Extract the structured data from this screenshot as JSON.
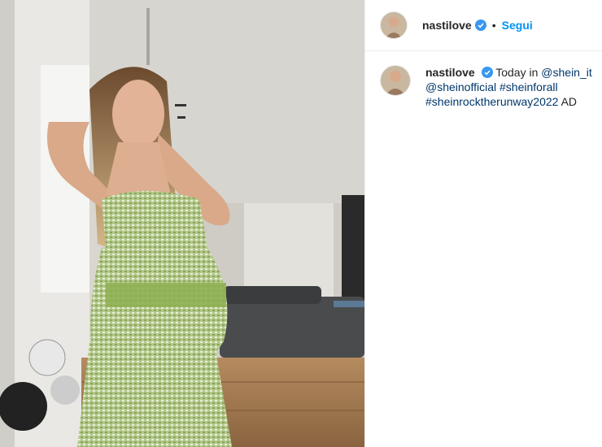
{
  "post": {
    "username": "nastilove",
    "follow_label": "Segui",
    "separator": "•",
    "caption": {
      "text_intro": "Today in",
      "mention_1": "@shein_it",
      "mention_2": "@sheinofficial",
      "hashtag_1": "#sheinforall",
      "hashtag_2": "#sheinrocktherunway2022",
      "suffix": "AD"
    }
  },
  "icons": {
    "verified": "verified-badge-icon"
  },
  "colors": {
    "accent": "#0095f6",
    "link": "#00376b",
    "verified": "#3897f0",
    "dress": "#a8c07a"
  }
}
